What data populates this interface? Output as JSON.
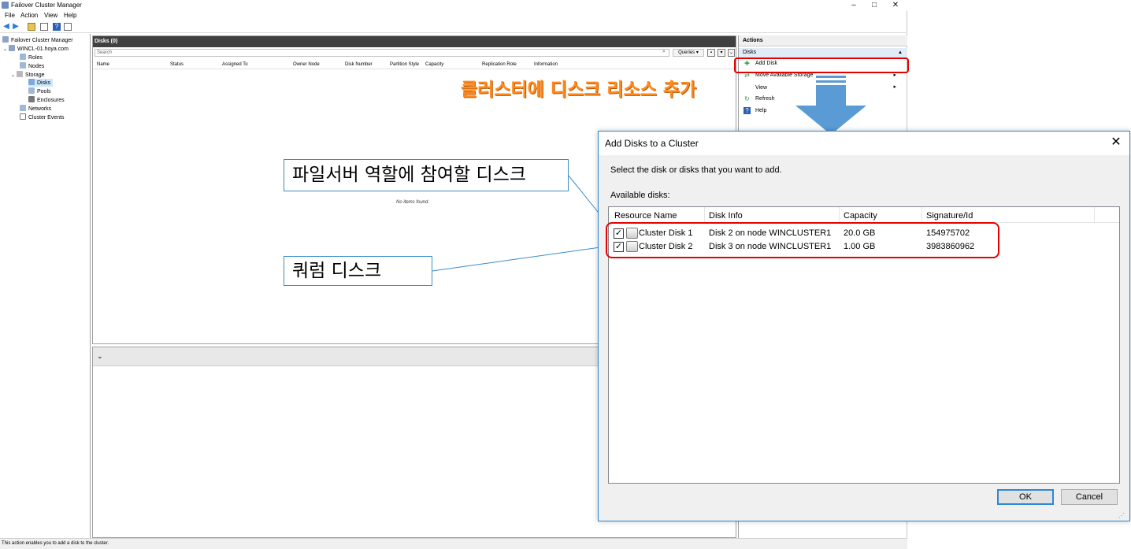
{
  "window": {
    "title": "Failover Cluster Manager",
    "controls": [
      "–",
      "□",
      "✕"
    ]
  },
  "menu": [
    "File",
    "Action",
    "View",
    "Help"
  ],
  "tree": {
    "root": "Failover Cluster Manager",
    "cluster": "WINCL-01.hoya.com",
    "roles": "Roles",
    "nodes": "Nodes",
    "storage": "Storage",
    "disks": "Disks",
    "pools": "Pools",
    "enclosures": "Enclosures",
    "networks": "Networks",
    "cluster_events": "Cluster Events"
  },
  "center": {
    "header": "Disks (0)",
    "search_placeholder": "Search",
    "queries_label": "Queries",
    "columns": [
      "Name",
      "Status",
      "Assigned To",
      "Owner Node",
      "Disk Number",
      "Partition Style",
      "Capacity",
      "Replication Role",
      "Information"
    ],
    "empty_text": "No items found."
  },
  "actions": {
    "title": "Actions",
    "section": "Disks",
    "items": [
      {
        "label": "Add Disk",
        "icon": "add-disk-icon"
      },
      {
        "label": "Move Available Storage",
        "icon": "move-storage-icon"
      },
      {
        "label": "View",
        "icon": "none"
      },
      {
        "label": "Refresh",
        "icon": "refresh-icon"
      },
      {
        "label": "Help",
        "icon": "help-icon"
      }
    ]
  },
  "statusbar": {
    "text": "This action enables you to add a disk to the cluster."
  },
  "annotations": {
    "orange_caption": "클러스터에 디스크 리소스 추가",
    "callout_file_server": "파일서버 역할에 참여할 디스크",
    "callout_quorum": "쿼럼 디스크",
    "accent_red": "#e60000",
    "accent_orange": "#ff8a1f",
    "arrow_blue": "#5b9bd5"
  },
  "dialog": {
    "title": "Add Disks to a Cluster",
    "instruction": "Select the disk or disks that you want to add.",
    "available_label": "Available disks:",
    "columns": [
      "Resource Name",
      "Disk Info",
      "Capacity",
      "Signature/Id"
    ],
    "rows": [
      {
        "checked": true,
        "name": "Cluster Disk 1",
        "info": "Disk 2 on node WINCLUSTER1",
        "capacity": "20.0 GB",
        "signature": "154975702"
      },
      {
        "checked": true,
        "name": "Cluster Disk 2",
        "info": "Disk 3 on node WINCLUSTER1",
        "capacity": "1.00 GB",
        "signature": "3983860962"
      }
    ],
    "ok_label": "OK",
    "cancel_label": "Cancel",
    "close_glyph": "✕"
  }
}
